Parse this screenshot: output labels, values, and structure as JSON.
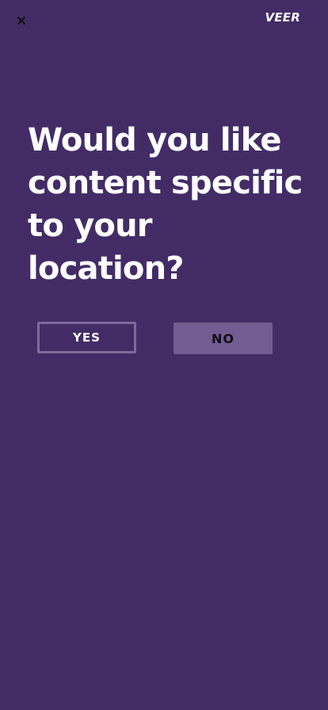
{
  "header": {
    "close_icon": "close-icon",
    "logo_text": "VEER"
  },
  "prompt": {
    "question": "Would you like content specific to your location?"
  },
  "actions": {
    "yes_label": "YES",
    "no_label": "NO"
  },
  "colors": {
    "background": "#432c66",
    "text": "#ffffff",
    "yes_border": "#7d6b9b",
    "no_fill": "#725c91",
    "no_text": "#0e0a14"
  }
}
